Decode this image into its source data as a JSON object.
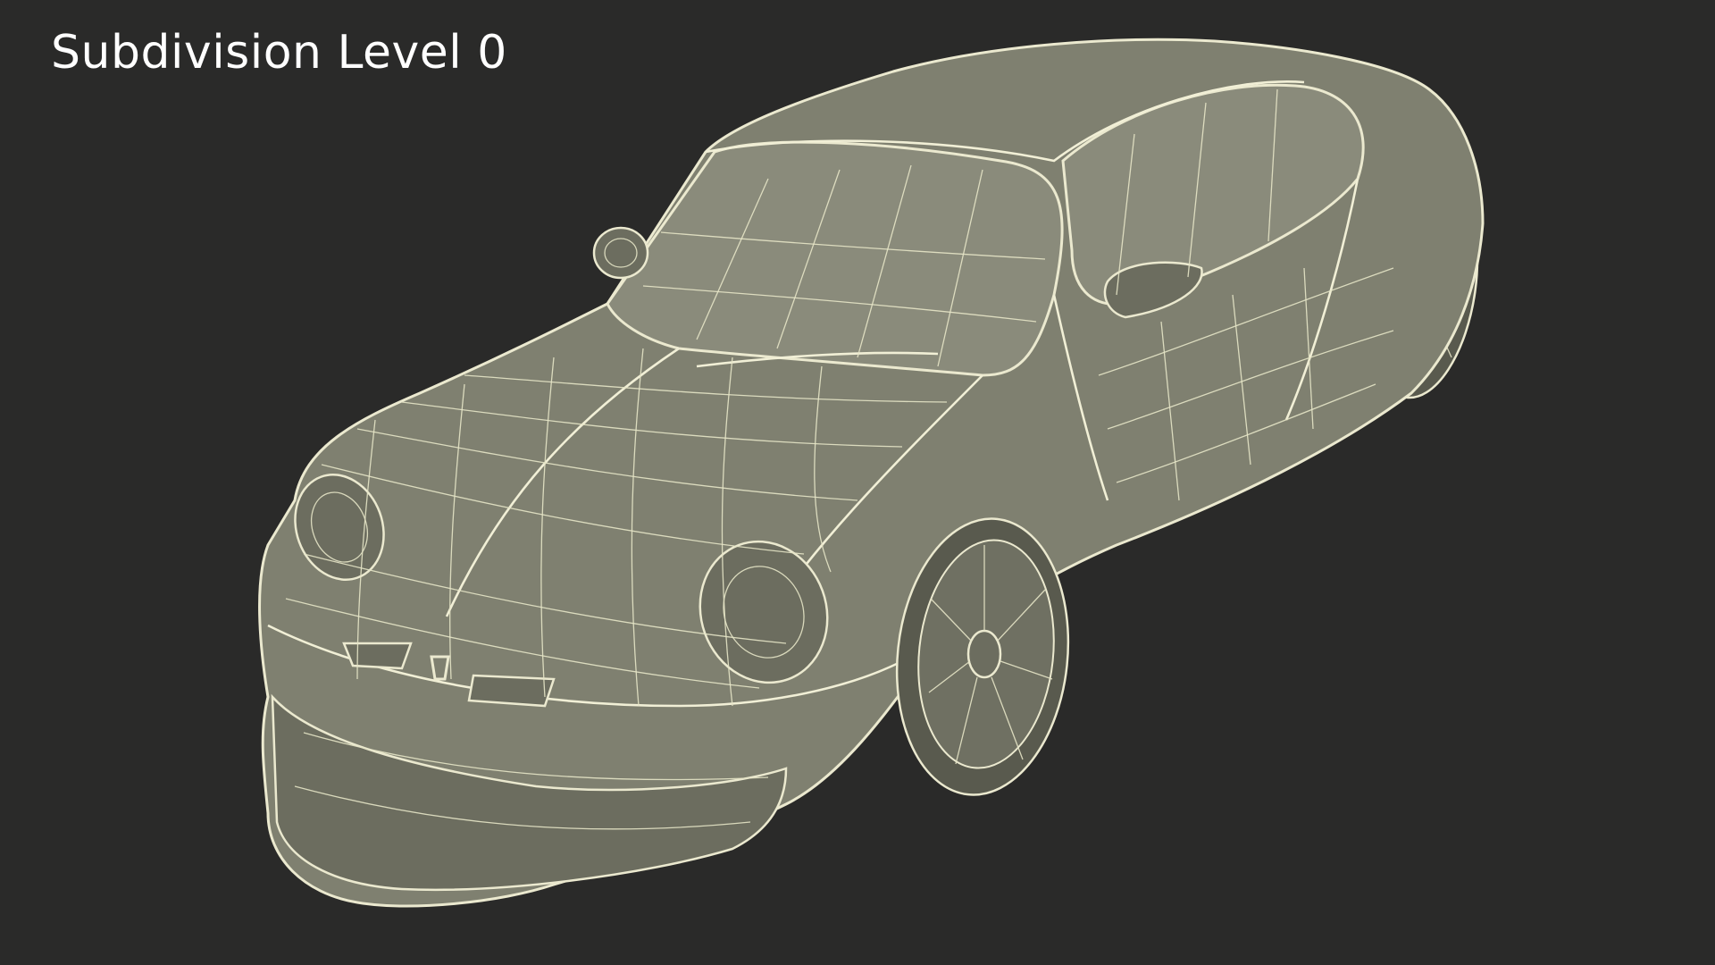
{
  "viewport": {
    "label": "Subdivision Level 0",
    "background_color": "#2a2a29",
    "wireframe_color": "#ebe9cf",
    "surface_color": "#7f8070"
  },
  "model": {
    "icon": "car-wireframe-icon"
  }
}
